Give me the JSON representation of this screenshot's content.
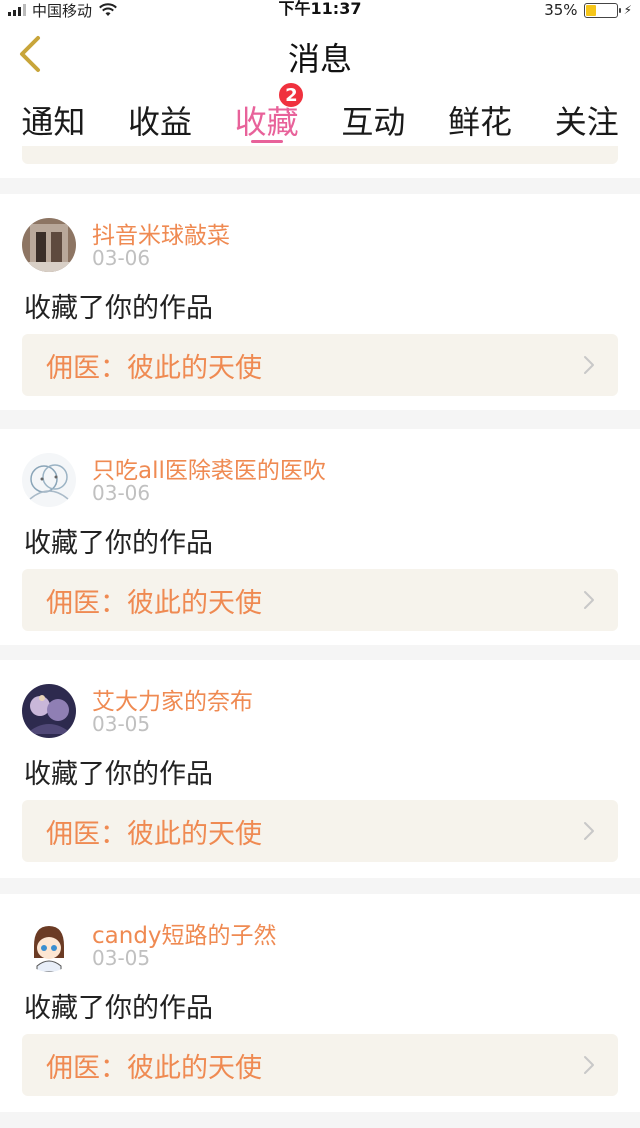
{
  "status_bar": {
    "carrier": "中国移动",
    "time": "下午11:37",
    "battery_percent": "35%",
    "battery_level": 0.35
  },
  "nav": {
    "title": "消息"
  },
  "tabs": [
    {
      "label": "通知",
      "active": false
    },
    {
      "label": "收益",
      "active": false
    },
    {
      "label": "收藏",
      "active": true,
      "badge": "2"
    },
    {
      "label": "互动",
      "active": false
    },
    {
      "label": "鲜花",
      "active": false
    },
    {
      "label": "关注",
      "active": false
    }
  ],
  "colors": {
    "accent": "#e8629a",
    "name": "#ef8a52",
    "badge": "#f0313e"
  },
  "messages": [
    {
      "user": "抖音米球敲菜",
      "date": "03-06",
      "action": "收藏了你的作品",
      "work": "佣医：彼此的天使"
    },
    {
      "user": "只吃all医除裘医的医吹",
      "date": "03-06",
      "action": "收藏了你的作品",
      "work": "佣医：彼此的天使"
    },
    {
      "user": "艾大力家的奈布",
      "date": "03-05",
      "action": "收藏了你的作品",
      "work": "佣医：彼此的天使"
    },
    {
      "user": "candy短路的子然",
      "date": "03-05",
      "action": "收藏了你的作品",
      "work": "佣医：彼此的天使"
    }
  ]
}
